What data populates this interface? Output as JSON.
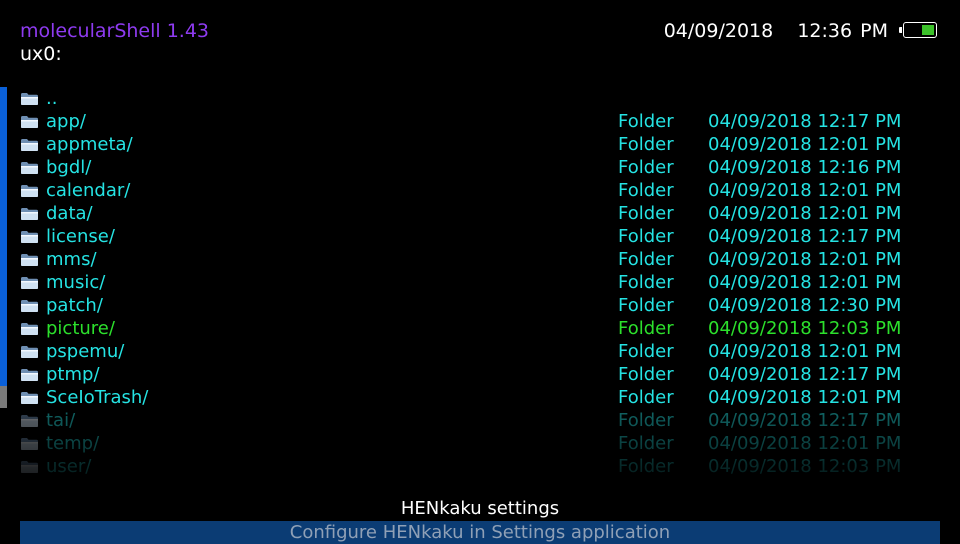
{
  "header": {
    "app_title": "molecularShell 1.43",
    "current_path": "ux0:",
    "date": "04/09/2018",
    "time": "12:36 PM",
    "battery_icon": "battery-icon",
    "battery_level_fraction": 0.45
  },
  "colors": {
    "title": "#8e3bf0",
    "entry": "#25e3e3",
    "selected": "#2ce02c",
    "scrollbar": "#0a60d8",
    "status_bar": "#0b3c74"
  },
  "file_list": {
    "icon": "folder-icon",
    "entries": [
      {
        "name": "..",
        "type": "",
        "date": ""
      },
      {
        "name": "app/",
        "type": "Folder",
        "date": "04/09/2018 12:17 PM"
      },
      {
        "name": "appmeta/",
        "type": "Folder",
        "date": "04/09/2018 12:01 PM"
      },
      {
        "name": "bgdl/",
        "type": "Folder",
        "date": "04/09/2018 12:16 PM"
      },
      {
        "name": "calendar/",
        "type": "Folder",
        "date": "04/09/2018 12:01 PM"
      },
      {
        "name": "data/",
        "type": "Folder",
        "date": "04/09/2018 12:01 PM"
      },
      {
        "name": "license/",
        "type": "Folder",
        "date": "04/09/2018 12:17 PM"
      },
      {
        "name": "mms/",
        "type": "Folder",
        "date": "04/09/2018 12:01 PM"
      },
      {
        "name": "music/",
        "type": "Folder",
        "date": "04/09/2018 12:01 PM"
      },
      {
        "name": "patch/",
        "type": "Folder",
        "date": "04/09/2018 12:30 PM"
      },
      {
        "name": "picture/",
        "type": "Folder",
        "date": "04/09/2018 12:03 PM",
        "selected": true
      },
      {
        "name": "pspemu/",
        "type": "Folder",
        "date": "04/09/2018 12:01 PM"
      },
      {
        "name": "ptmp/",
        "type": "Folder",
        "date": "04/09/2018 12:17 PM"
      },
      {
        "name": "SceIoTrash/",
        "type": "Folder",
        "date": "04/09/2018 12:01 PM"
      },
      {
        "name": "tai/",
        "type": "Folder",
        "date": "04/09/2018 12:17 PM"
      },
      {
        "name": "temp/",
        "type": "Folder",
        "date": "04/09/2018 12:01 PM"
      },
      {
        "name": "user/",
        "type": "Folder",
        "date": "04/09/2018 12:03 PM"
      }
    ]
  },
  "status": {
    "title": "HENkaku settings",
    "description": "Configure HENkaku in Settings application"
  }
}
